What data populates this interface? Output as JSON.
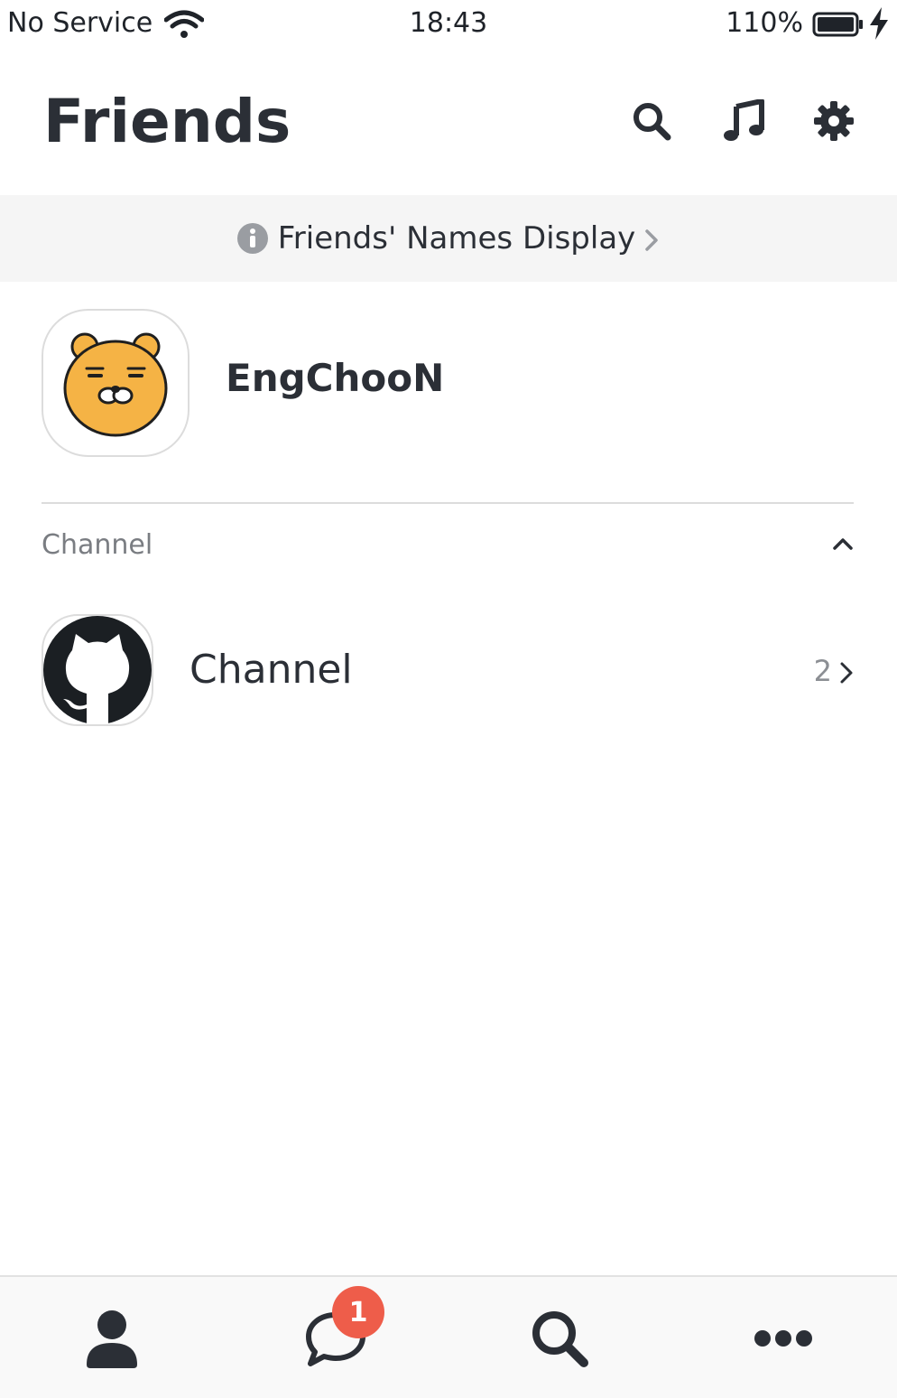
{
  "status_bar": {
    "carrier": "No Service",
    "time": "18:43",
    "battery_percent": "110%",
    "icons": [
      "wifi-icon",
      "battery-icon",
      "charging-bolt-icon"
    ]
  },
  "header": {
    "title": "Friends",
    "actions": [
      "search-icon",
      "music-note-icon",
      "gear-icon"
    ]
  },
  "notice": {
    "text": "Friends' Names Display",
    "icon": "info-icon"
  },
  "profile": {
    "name": "EngChooN",
    "avatar_icon": "bear-face-icon"
  },
  "channel_section": {
    "title": "Channel",
    "expanded": true,
    "items": [
      {
        "name": "Channel",
        "count": "2",
        "avatar_icon": "github-octocat-icon"
      }
    ]
  },
  "tab_bar": {
    "tabs": [
      {
        "icon": "person-icon",
        "active": true
      },
      {
        "icon": "chat-bubble-icon",
        "badge": "1",
        "active": false
      },
      {
        "icon": "search-icon",
        "active": false
      },
      {
        "icon": "more-dots-icon",
        "active": false
      }
    ]
  },
  "colors": {
    "badge": "#ee5d4a",
    "text_primary": "#2b2f36",
    "text_secondary": "#7a7d82",
    "notice_bg": "#f5f5f5",
    "bear_fill": "#f5b345"
  }
}
